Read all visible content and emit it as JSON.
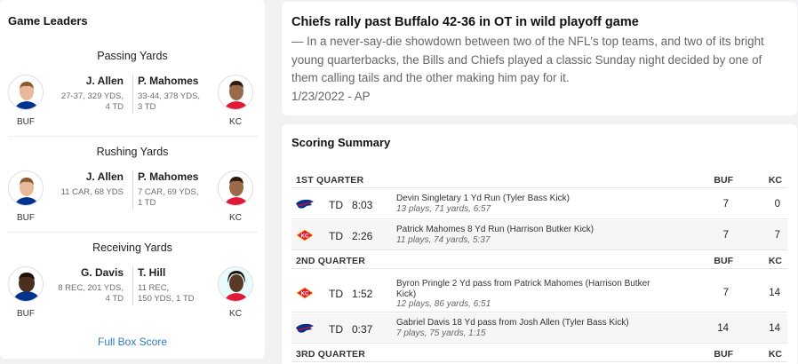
{
  "leaders": {
    "title": "Game Leaders",
    "sections": [
      {
        "category": "Passing Yards",
        "left": {
          "name": "J. Allen",
          "stats1": "27-37, 329 YDS,",
          "stats2": "4 TD",
          "team": "BUF"
        },
        "right": {
          "name": "P. Mahomes",
          "stats1": "33-44, 378 YDS,",
          "stats2": "3 TD",
          "team": "KC"
        }
      },
      {
        "category": "Rushing Yards",
        "left": {
          "name": "J. Allen",
          "stats1": "11 CAR, 68 YDS",
          "stats2": "",
          "team": "BUF"
        },
        "right": {
          "name": "P. Mahomes",
          "stats1": "7 CAR, 69 YDS,",
          "stats2": "1 TD",
          "team": "KC"
        }
      },
      {
        "category": "Receiving Yards",
        "left": {
          "name": "G. Davis",
          "stats1": "8 REC, 201 YDS,",
          "stats2": "4 TD",
          "team": "BUF"
        },
        "right": {
          "name": "T. Hill",
          "stats1": "11 REC,",
          "stats2": "150 YDS, 1 TD",
          "team": "KC"
        }
      }
    ],
    "box_score_link": "Full Box Score"
  },
  "news": {
    "headline": "Chiefs rally past Buffalo 42-36 in OT in wild playoff game",
    "body": "— In a never-say-die showdown between two of the NFL's top teams, and two of its bright young quarterbacks, the Bills and Chiefs played a classic Sunday night decided by one of them calling tails and the other making him pay for it.",
    "date": "1/23/2022 - AP"
  },
  "scoring": {
    "title": "Scoring Summary",
    "team1": "BUF",
    "team2": "KC",
    "quarters": [
      {
        "label": "1ST QUARTER",
        "plays": [
          {
            "team": "BUF",
            "type": "TD",
            "time": "8:03",
            "desc": "Devin Singletary 1 Yd Run (Tyler Bass Kick)",
            "sub": "13 plays, 71 yards, 6:57",
            "buf": "7",
            "kc": "0"
          },
          {
            "team": "KC",
            "type": "TD",
            "time": "2:26",
            "desc": "Patrick Mahomes 8 Yd Run (Harrison Butker Kick)",
            "sub": "11 plays, 74 yards, 5:37",
            "buf": "7",
            "kc": "7"
          }
        ]
      },
      {
        "label": "2ND QUARTER",
        "plays": [
          {
            "team": "KC",
            "type": "TD",
            "time": "1:52",
            "desc": "Byron Pringle 2 Yd pass from Patrick Mahomes (Harrison Butker Kick)",
            "sub": "12 plays, 86 yards, 6:51",
            "buf": "7",
            "kc": "14"
          },
          {
            "team": "BUF",
            "type": "TD",
            "time": "0:37",
            "desc": "Gabriel Davis 18 Yd pass from Josh Allen (Tyler Bass Kick)",
            "sub": "7 plays, 75 yards, 1:15",
            "buf": "14",
            "kc": "14"
          }
        ]
      },
      {
        "label": "3RD QUARTER",
        "plays": []
      }
    ]
  },
  "colors": {
    "bills_blue": "#00338d",
    "bills_red": "#c60c30",
    "chiefs_red": "#e31837",
    "chiefs_gold": "#ffb81c",
    "link_blue": "#2b7bc7"
  }
}
